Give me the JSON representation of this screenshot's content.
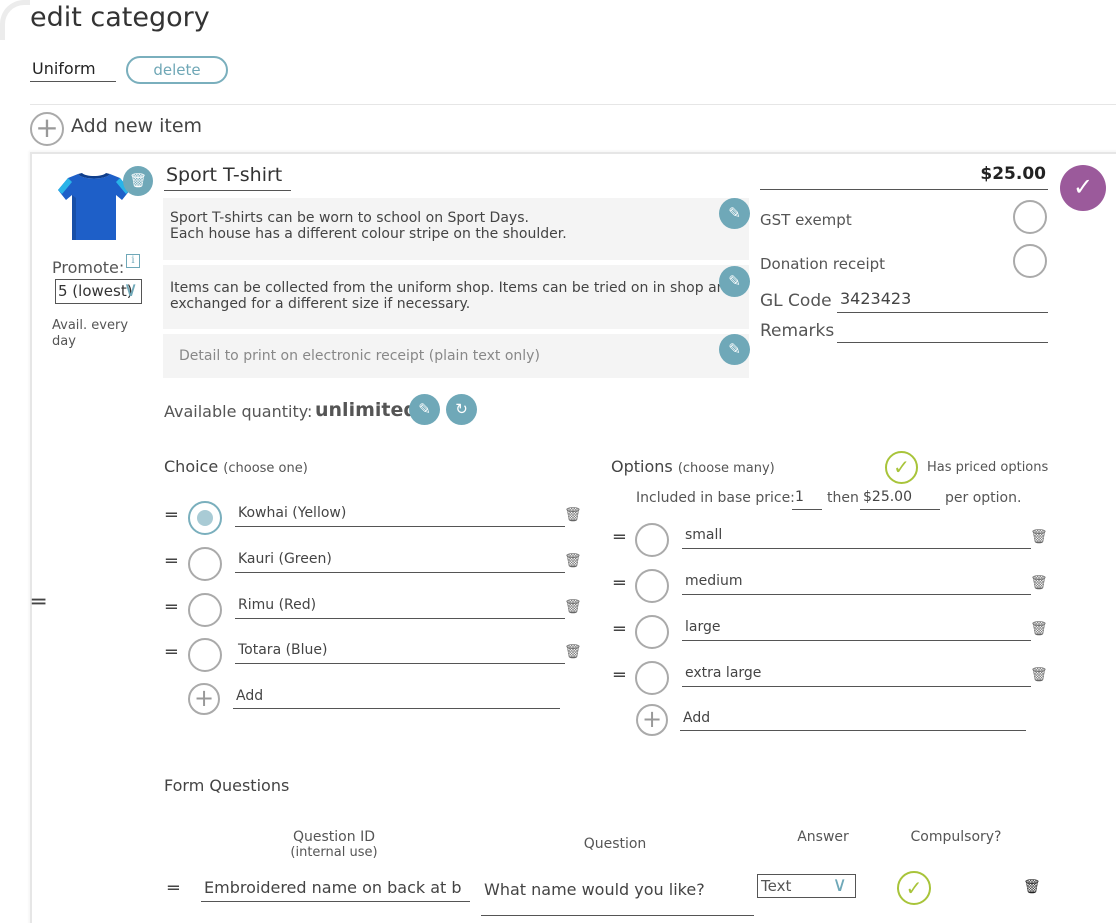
{
  "page": {
    "title": "edit category"
  },
  "category": {
    "name": "Uniform",
    "delete_label": "delete"
  },
  "add_item": {
    "label": "Add new item"
  },
  "item": {
    "name": "Sport T-shirt",
    "price": "$25.00",
    "description": "Sport T-shirts can be worn to school on Sport Days.\nEach house has a different colour stripe on the shoulder.",
    "collection_info": "Items can be collected from the uniform shop. Items can be tried on in shop and exchanged for a different size if necessary.",
    "receipt_placeholder": "Detail to print on electronic receipt (plain text only)",
    "promote_label": "Promote:",
    "promote_value": "5 (lowest)",
    "availability": "Avail. every day",
    "gst_exempt_label": "GST exempt",
    "donation_receipt_label": "Donation receipt",
    "gl_code_label": "GL Code",
    "gl_code_value": "3423423",
    "remarks_label": "Remarks",
    "remarks_value": "",
    "available_quantity_label": "Available quantity:",
    "available_quantity_value": "unlimited"
  },
  "choice": {
    "title": "Choice",
    "hint": "(choose one)",
    "options": [
      "Kowhai (Yellow)",
      "Kauri (Green)",
      "Rimu (Red)",
      "Totara (Blue)"
    ],
    "selected_index": 0,
    "add_label": "Add"
  },
  "options": {
    "title": "Options",
    "hint": "(choose many)",
    "has_priced_label": "Has priced options",
    "included_label": "Included in base price:",
    "included_value": "1",
    "then_label": "then",
    "then_value": "$25.00",
    "per_option_label": "per option.",
    "items": [
      "small",
      "medium",
      "large",
      "extra large"
    ],
    "add_label": "Add"
  },
  "form_questions": {
    "title": "Form Questions",
    "headers": {
      "question_id": "Question ID",
      "question_id_sub": "(internal use)",
      "question": "Question",
      "answer": "Answer",
      "compulsory": "Compulsory?"
    },
    "rows": [
      {
        "id": "Embroidered name on back at b",
        "question": "What name would you like?",
        "answer": "Text"
      }
    ]
  },
  "colors": {
    "accent_teal": "#6fa8b8",
    "save_purple": "#9b5a9b",
    "check_green": "#a8c43a"
  }
}
